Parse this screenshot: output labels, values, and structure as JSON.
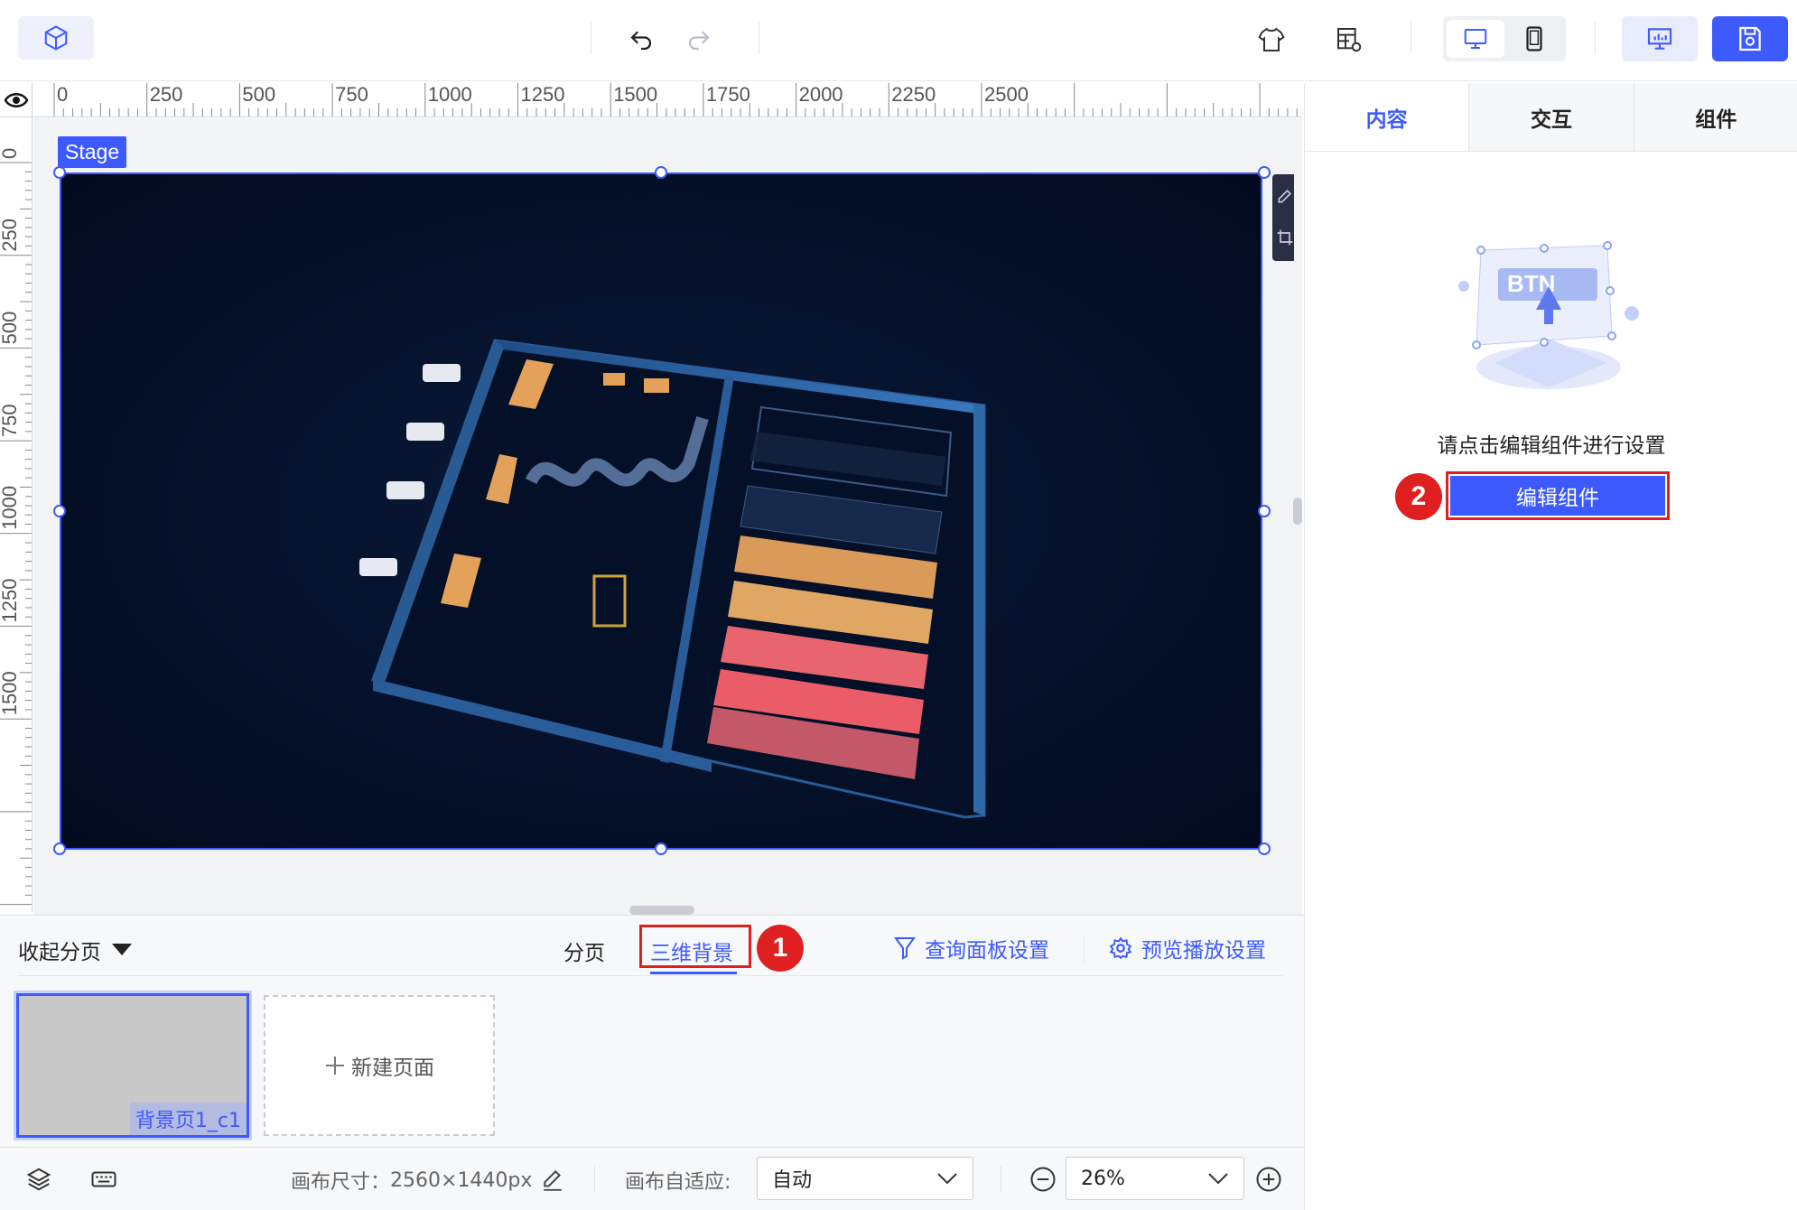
{
  "toolbar": {
    "logo_icon": "cube-icon",
    "undo_icon": "undo-icon",
    "redo_icon": "redo-icon",
    "theme_icon": "shirt-icon",
    "data_icon": "table-settings-icon",
    "device_desktop_icon": "desktop-icon",
    "device_mobile_icon": "mobile-icon",
    "preview_icon": "presentation-icon",
    "save_icon": "save-icon",
    "accent_color": "#3d5afe"
  },
  "ruler": {
    "top_ticks": [
      "0",
      "250",
      "500",
      "750",
      "1000",
      "1250",
      "1500",
      "1750",
      "2000",
      "2250",
      "2500"
    ],
    "left_ticks": [
      "0",
      "250",
      "500",
      "750",
      "1000",
      "1250",
      "1500"
    ]
  },
  "stage": {
    "label": "Stage",
    "canvas_bg": "#020a1e"
  },
  "right_panel": {
    "tabs": [
      {
        "label": "内容",
        "active": true
      },
      {
        "label": "交互",
        "active": false
      },
      {
        "label": "组件",
        "active": false
      }
    ],
    "illustration_text": "BTN",
    "hint": "请点击编辑组件进行设置",
    "edit_button": "编辑组件",
    "marker": "2"
  },
  "pages": {
    "collapse_label": "收起分页",
    "tabs": [
      {
        "label": "分页",
        "active": false
      },
      {
        "label": "三维背景",
        "active": true
      }
    ],
    "marker": "1",
    "query_panel": "查询面板设置",
    "preview_settings": "预览播放设置",
    "thumbnail_label": "背景页1_c1",
    "new_page": "新建页面"
  },
  "status": {
    "canvas_size_label": "画布尺寸：",
    "canvas_size_value": "2560×1440px",
    "fit_label": "画布自适应:",
    "fit_value": "自动",
    "zoom_value": "26%"
  }
}
